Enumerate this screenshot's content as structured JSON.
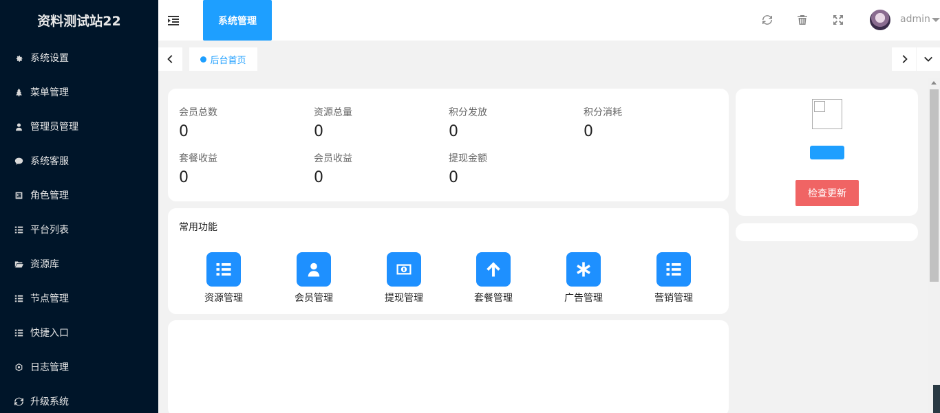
{
  "app": {
    "title": "资料测试站22"
  },
  "sidebar": {
    "items": [
      {
        "label": "系统设置",
        "icon": "gear-icon"
      },
      {
        "label": "菜单管理",
        "icon": "tree-icon"
      },
      {
        "label": "管理员管理",
        "icon": "user-icon"
      },
      {
        "label": "系统客服",
        "icon": "chat-icon"
      },
      {
        "label": "角色管理",
        "icon": "id-card-icon"
      },
      {
        "label": "平台列表",
        "icon": "list-icon"
      },
      {
        "label": "资源库",
        "icon": "folder-icon"
      },
      {
        "label": "节点管理",
        "icon": "list-icon"
      },
      {
        "label": "快捷入口",
        "icon": "list-icon"
      },
      {
        "label": "日志管理",
        "icon": "hexagon-icon"
      },
      {
        "label": "升级系统",
        "icon": "refresh-icon"
      }
    ]
  },
  "header": {
    "active_tab": "系统管理",
    "user": "admin"
  },
  "tabs": {
    "home": "后台首页"
  },
  "stats": [
    {
      "label": "会员总数",
      "value": "0"
    },
    {
      "label": "资源总量",
      "value": "0"
    },
    {
      "label": "积分发放",
      "value": "0"
    },
    {
      "label": "积分消耗",
      "value": "0"
    },
    {
      "label": "套餐收益",
      "value": "0"
    },
    {
      "label": "会员收益",
      "value": "0"
    },
    {
      "label": "提现金额",
      "value": "0"
    }
  ],
  "functions": {
    "title": "常用功能",
    "items": [
      {
        "label": "资源管理",
        "icon": "list-icon"
      },
      {
        "label": "会员管理",
        "icon": "user-icon"
      },
      {
        "label": "提现管理",
        "icon": "money-icon"
      },
      {
        "label": "套餐管理",
        "icon": "arrow-up-icon"
      },
      {
        "label": "广告管理",
        "icon": "asterisk-icon"
      },
      {
        "label": "营销管理",
        "icon": "list-icon"
      }
    ]
  },
  "right_panel": {
    "update_button": "检查更新"
  },
  "colors": {
    "sidebar_bg": "#001529",
    "accent": "#1e9fff",
    "danger": "#f06464"
  }
}
